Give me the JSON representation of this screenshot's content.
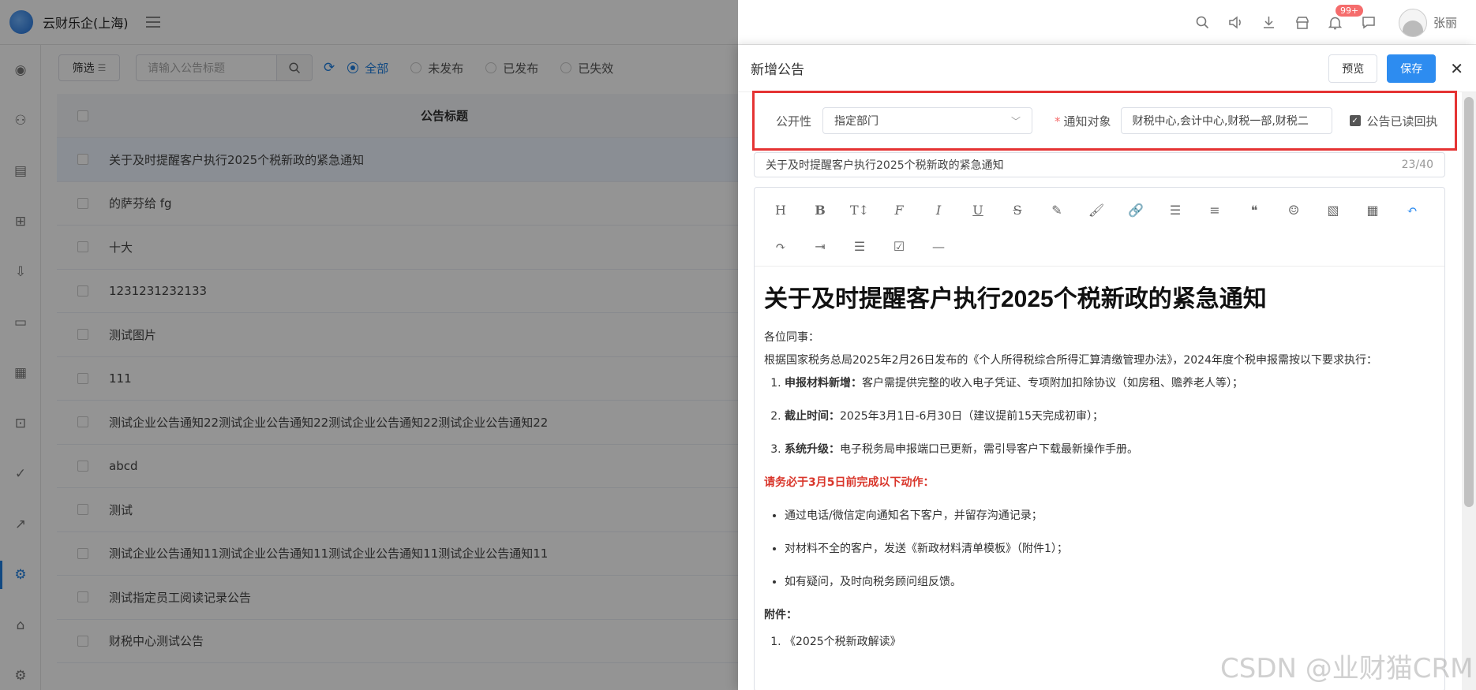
{
  "app": {
    "company": "云财乐企(上海)",
    "badge_count": "99+",
    "user_name": "张丽"
  },
  "sidebar_icons": [
    "location-icon",
    "users-icon",
    "document-icon",
    "calendar-plus-icon",
    "inbox-download-icon",
    "card-icon",
    "calendar-icon",
    "presentation-icon",
    "check-circle-icon",
    "chart-icon",
    "settings-icon",
    "store-icon",
    "gear-icon"
  ],
  "filterbar": {
    "filter_label": "筛选",
    "search_placeholder": "请输入公告标题",
    "radios": [
      {
        "label": "全部",
        "checked": true
      },
      {
        "label": "未发布",
        "checked": false
      },
      {
        "label": "已发布",
        "checked": false
      },
      {
        "label": "已失效",
        "checked": false
      }
    ]
  },
  "table": {
    "header_title": "公告标题",
    "rows": [
      "关于及时提醒客户执行2025个税新政的紧急通知",
      "的萨芬给 fg",
      "十大",
      "1231231232133",
      "测试图片",
      "111",
      "测试企业公告通知22测试企业公告通知22测试企业公告通知22测试企业公告通知22",
      "abcd",
      "测试",
      "测试企业公告通知11测试企业公告通知11测试企业公告通知11测试企业公告通知11",
      "测试指定员工阅读记录公告",
      "财税中心测试公告"
    ]
  },
  "drawer": {
    "title": "新增公告",
    "preview_label": "预览",
    "save_label": "保存",
    "visibility_label": "公开性",
    "visibility_value": "指定部门",
    "target_label": "通知对象",
    "target_value": "财税中心,会计中心,财税一部,财税二",
    "receipt_label": "公告已读回执",
    "title_value": "关于及时提醒客户执行2025个税新政的紧急通知",
    "title_count": "23/40"
  },
  "content": {
    "heading": "关于及时提醒客户执行2025个税新政的紧急通知",
    "greeting": "各位同事：",
    "intro": "根据国家税务总局2025年2月26日发布的《个人所得税综合所得汇算清缴管理办法》，2024年度个税申报需按以下要求执行：",
    "items": [
      {
        "bold": "申报材料新增：",
        "text": "客户需提供完整的收入电子凭证、专项附加扣除协议（如房租、赡养老人等）；"
      },
      {
        "bold": "截止时间：",
        "text": "2025年3月1日-6月30日（建议提前15天完成初审）；"
      },
      {
        "bold": "系统升级：",
        "text": "电子税务局申报端口已更新，需引导客户下载最新操作手册。"
      }
    ],
    "red_note": "请务必于3月5日前完成以下动作：",
    "bullets": [
      "通过电话/微信定向通知名下客户，并留存沟通记录；",
      "对材料不全的客户，发送《新政材料清单模板》（附件1）；",
      "如有疑问，及时向税务顾问组反馈。"
    ],
    "attach_label": "附件：",
    "attachments": [
      "《2025个税新政解读》"
    ]
  },
  "watermark": "CSDN @业财猫CRM",
  "colors": {
    "accent": "#2d8cf0",
    "highlight_border": "#e53333",
    "red_text": "#d9362b"
  }
}
